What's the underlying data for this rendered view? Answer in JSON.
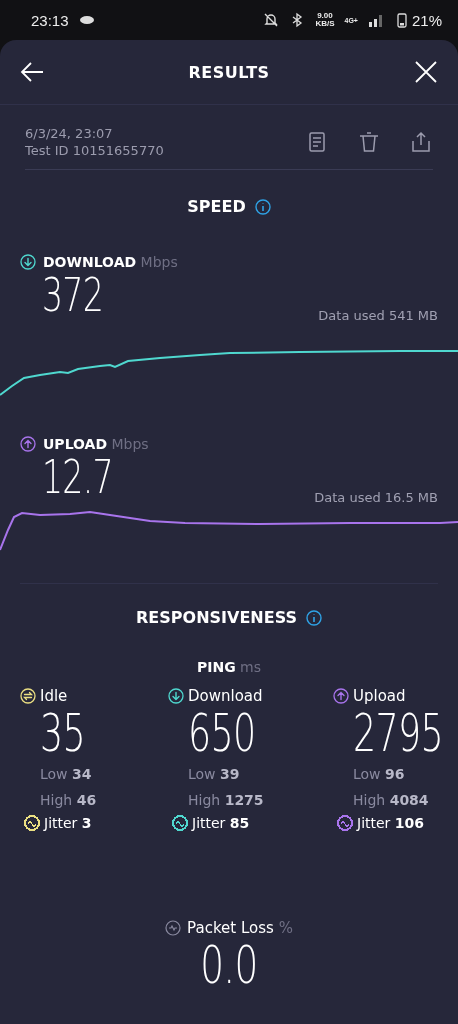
{
  "status_bar": {
    "time": "23:13",
    "net_speed": "9.00",
    "net_speed_unit": "KB/S",
    "network": "4G+",
    "battery": "21%"
  },
  "header": {
    "title": "RESULTS"
  },
  "test": {
    "date": "6/3/24, 23:07",
    "test_id": "Test ID 10151655770"
  },
  "speed": {
    "title": "SPEED",
    "metrics": [
      {
        "kind": "download",
        "label": "DOWNLOAD",
        "unit": "Mbps",
        "value": "372",
        "data_used": "Data used 541 MB",
        "color": "#4fd8cf"
      },
      {
        "kind": "upload",
        "label": "UPLOAD",
        "unit": "Mbps",
        "value": "12.7",
        "data_used": "Data used 16.5 MB",
        "color": "#a874ec"
      }
    ]
  },
  "responsiveness": {
    "title": "RESPONSIVENESS",
    "ping_label": "PING",
    "ping_unit": "ms",
    "columns": [
      {
        "kind": "idle",
        "label": "Idle",
        "value": "35",
        "low": "Low **34**",
        "high": "High **46**",
        "jitter": "Jitter **3**",
        "color": "#ebdf82"
      },
      {
        "kind": "download",
        "label": "Download",
        "value": "650",
        "low": "Low **39**",
        "high": "High **1275**",
        "jitter": "Jitter **85**",
        "color": "#4fd8cf"
      },
      {
        "kind": "upload",
        "label": "Upload",
        "value": "2795",
        "low": "Low **96**",
        "high": "High **4084**",
        "jitter": "Jitter **106**",
        "color": "#a874ec"
      }
    ]
  },
  "packet_loss": {
    "label": "Packet Loss",
    "unit": "%",
    "value": "0.0"
  }
}
